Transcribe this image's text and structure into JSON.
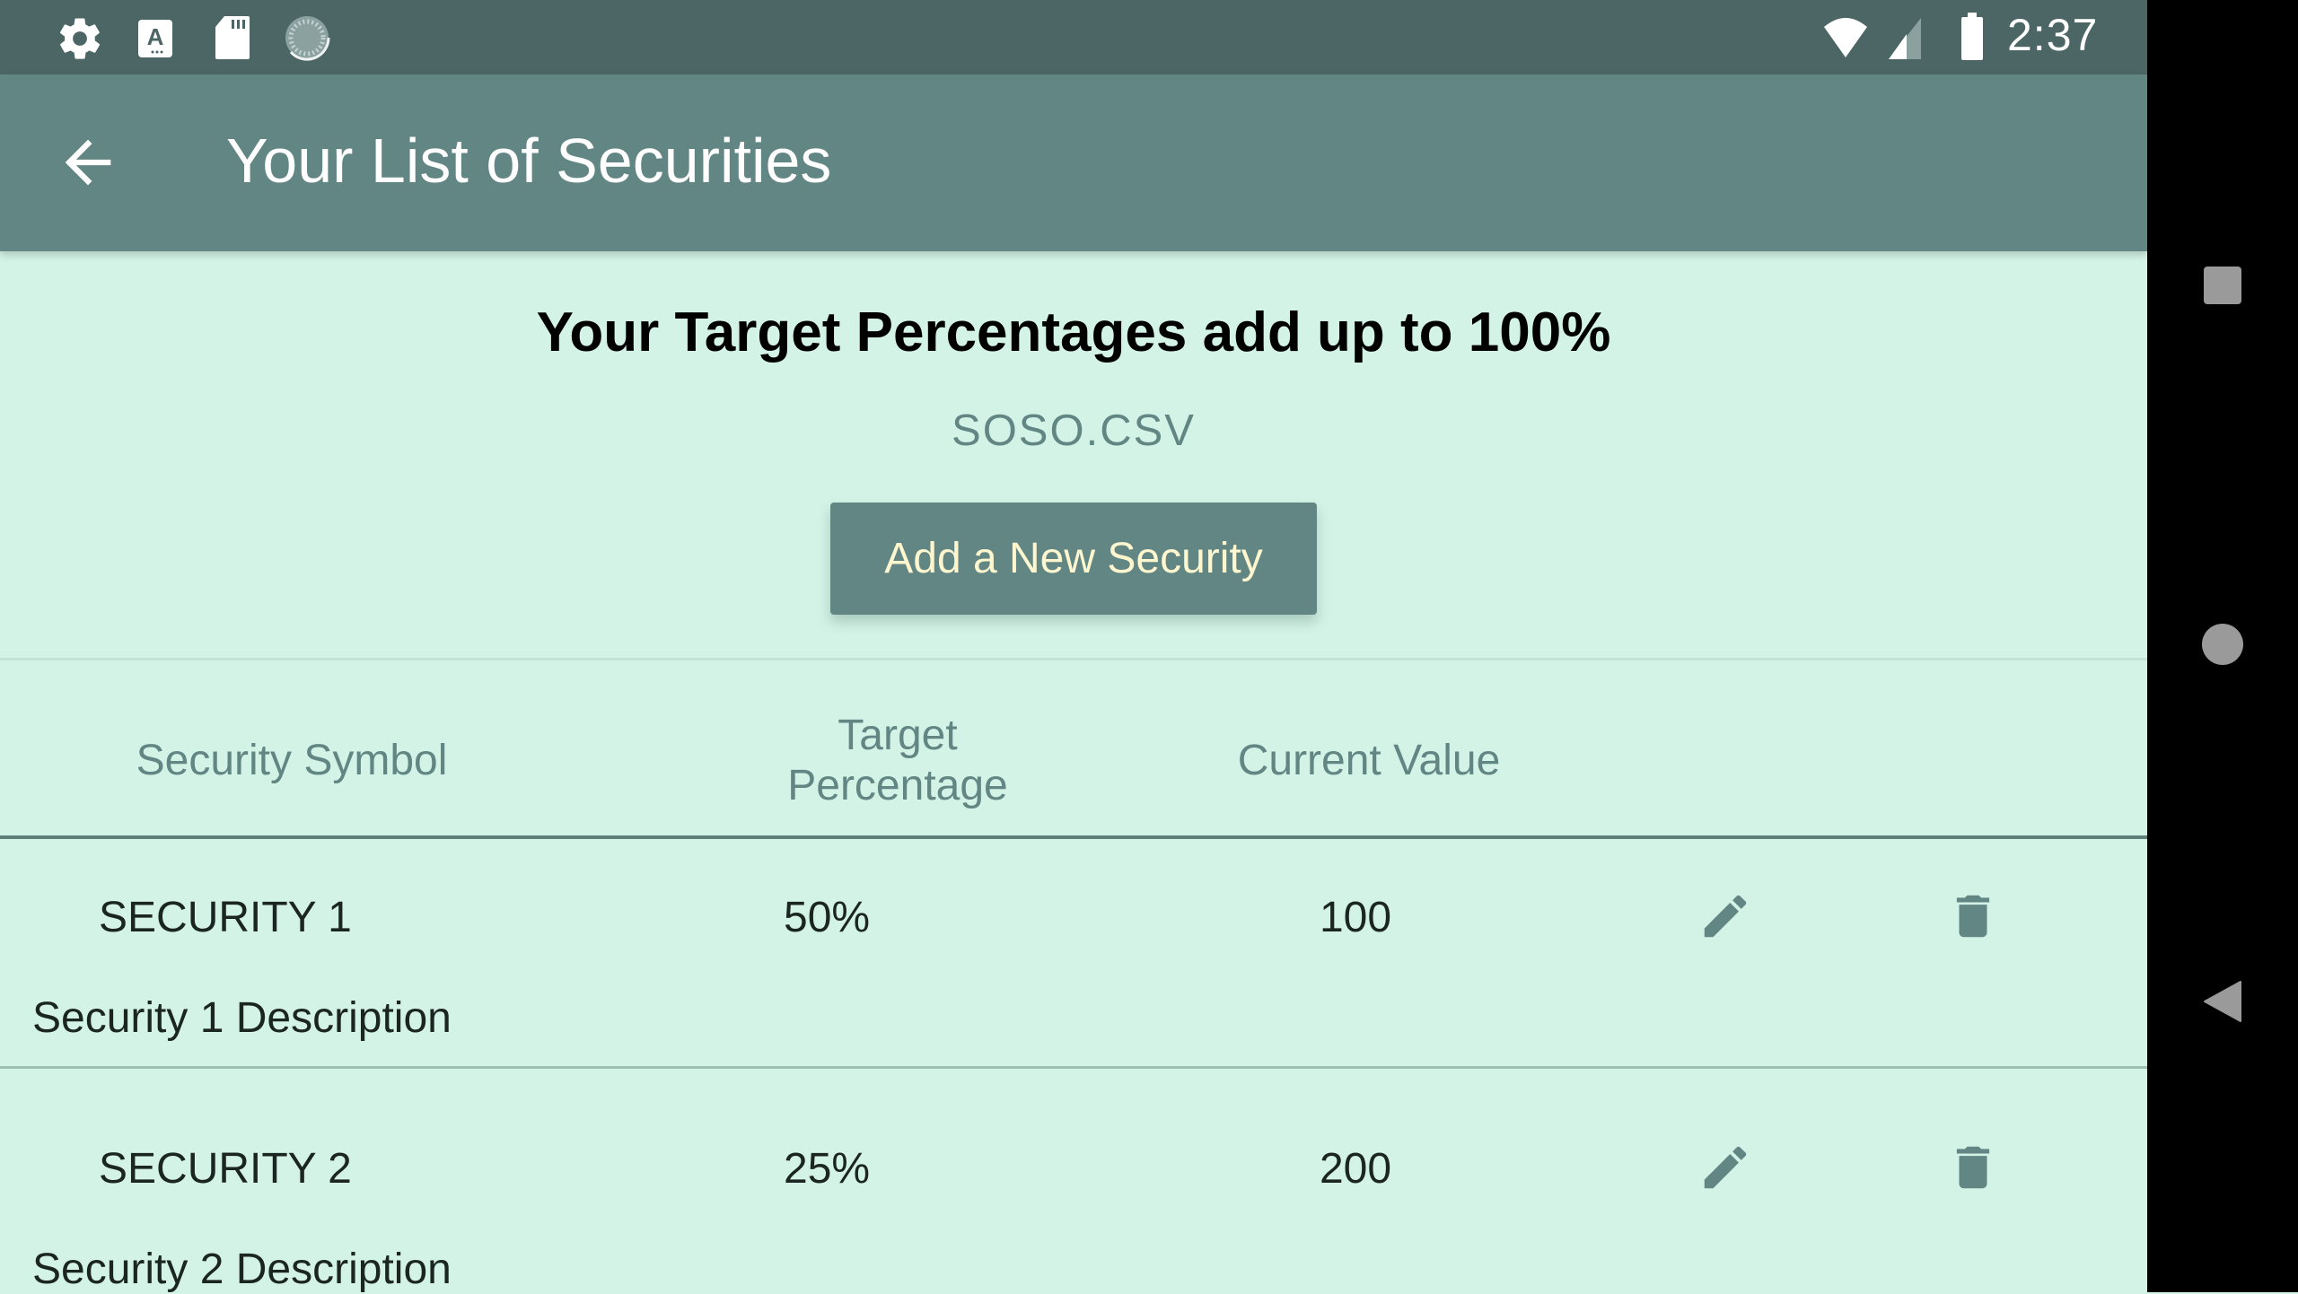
{
  "status_bar": {
    "left_icons": [
      "settings-gear-icon",
      "keyboard-a-icon",
      "sd-card-icon",
      "sync-loading-icon"
    ],
    "right_icons": [
      "wifi-icon",
      "cellular-signal-icon",
      "battery-icon"
    ],
    "time": "2:37"
  },
  "app_bar": {
    "back_icon": "arrow-back-icon",
    "title": "Your List of Securities"
  },
  "content": {
    "summary_heading": "Your Target Percentages add up to 100%",
    "file_name": "SOSO.CSV",
    "add_button_label": "Add a New Security"
  },
  "table": {
    "headers": {
      "symbol": "Security Symbol",
      "target_line1": "Target",
      "target_line2": "Percentage",
      "value": "Current Value"
    },
    "rows": [
      {
        "symbol": "SECURITY 1",
        "target": "50%",
        "value": "100",
        "description": "Security 1 Description"
      },
      {
        "symbol": "SECURITY 2",
        "target": "25%",
        "value": "200",
        "description": "Security 2 Description"
      }
    ],
    "row_actions": [
      "edit-pencil-icon",
      "delete-trash-icon"
    ]
  },
  "nav_bar": {
    "buttons": [
      "recents-square",
      "home-circle",
      "back-triangle"
    ]
  },
  "colors": {
    "status_bar": "#4b6665",
    "app_bar": "#628683",
    "background": "#d4f3e7",
    "accent": "#628683",
    "button_text": "#fdf6cf"
  }
}
